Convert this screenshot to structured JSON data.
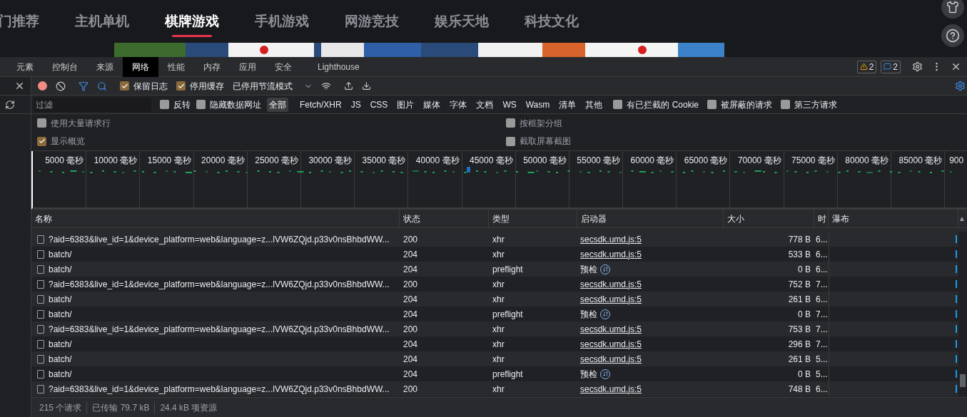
{
  "site_nav": {
    "items": [
      {
        "label": "门推荐",
        "selected": false
      },
      {
        "label": "主机单机",
        "selected": false
      },
      {
        "label": "棋牌游戏",
        "selected": true
      },
      {
        "label": "手机游戏",
        "selected": false
      },
      {
        "label": "网游竞技",
        "selected": false
      },
      {
        "label": "娱乐天地",
        "selected": false
      },
      {
        "label": "科技文化",
        "selected": false
      }
    ]
  },
  "devtools": {
    "tabs": [
      {
        "label": "元素",
        "selected": false
      },
      {
        "label": "控制台",
        "selected": false
      },
      {
        "label": "来源",
        "selected": false
      },
      {
        "label": "网络",
        "selected": true
      },
      {
        "label": "性能",
        "selected": false
      },
      {
        "label": "内存",
        "selected": false
      },
      {
        "label": "应用",
        "selected": false
      },
      {
        "label": "安全",
        "selected": false
      },
      {
        "label": "Lighthouse",
        "selected": false
      }
    ],
    "warnings": "2",
    "messages": "2",
    "toolbar": {
      "recording": true,
      "preserve_log": {
        "label": "保留日志",
        "checked": true
      },
      "disable_cache": {
        "label": "停用缓存",
        "checked": true
      },
      "throttle": "已停用节流模式"
    },
    "filter": {
      "placeholder": "过滤",
      "invert": {
        "label": "反转",
        "checked": false
      },
      "hide_data_urls": {
        "label": "隐藏数据网址",
        "checked": false
      },
      "types": [
        {
          "label": "全部",
          "selected": true
        },
        {
          "label": "Fetch/XHR",
          "selected": false
        },
        {
          "label": "JS",
          "selected": false
        },
        {
          "label": "CSS",
          "selected": false
        },
        {
          "label": "图片",
          "selected": false
        },
        {
          "label": "媒体",
          "selected": false
        },
        {
          "label": "字体",
          "selected": false
        },
        {
          "label": "文档",
          "selected": false
        },
        {
          "label": "WS",
          "selected": false
        },
        {
          "label": "Wasm",
          "selected": false
        },
        {
          "label": "清单",
          "selected": false
        },
        {
          "label": "其他",
          "selected": false
        }
      ],
      "extra": [
        {
          "label": "有已拦截的 Cookie",
          "checked": false
        },
        {
          "label": "被屏蔽的请求",
          "checked": false
        },
        {
          "label": "第三方请求",
          "checked": false
        }
      ]
    },
    "options_left": [
      {
        "label": "使用大量请求行",
        "checked": false
      },
      {
        "label": "显示概览",
        "checked": true
      }
    ],
    "options_right": [
      {
        "label": "按框架分组",
        "checked": false
      },
      {
        "label": "截取屏幕截图",
        "checked": false
      }
    ],
    "timeline_ticks": [
      "5000 毫秒",
      "10000 毫秒",
      "15000 毫秒",
      "20000 毫秒",
      "25000 毫秒",
      "30000 毫秒",
      "35000 毫秒",
      "40000 毫秒",
      "45000 毫秒",
      "50000 毫秒",
      "55000 毫秒",
      "60000 毫秒",
      "65000 毫秒",
      "70000 毫秒",
      "75000 毫秒",
      "80000 毫秒",
      "85000 毫秒",
      "900"
    ],
    "columns": [
      "名称",
      "状态",
      "类型",
      "启动器",
      "大小",
      "时",
      "瀑布"
    ],
    "sort_indicator": "▲",
    "rows": [
      {
        "name": "?aid=6383&live_id=1&device_platform=web&language=z...lVW6ZQjd.p33v0nsBhbdWW...",
        "status": "200",
        "type": "xhr",
        "initiator": "secsdk.umd.js:5",
        "kind": "link",
        "size": "778 B",
        "time": "6..."
      },
      {
        "name": "batch/",
        "status": "204",
        "type": "xhr",
        "initiator": "secsdk.umd.js:5",
        "kind": "link",
        "size": "533 B",
        "time": "6..."
      },
      {
        "name": "batch/",
        "status": "204",
        "type": "preflight",
        "initiator": "预检",
        "kind": "preflight",
        "size": "0 B",
        "time": "6..."
      },
      {
        "name": "?aid=6383&live_id=1&device_platform=web&language=z...lVW6ZQjd.p33v0nsBhbdWW...",
        "status": "200",
        "type": "xhr",
        "initiator": "secsdk.umd.js:5",
        "kind": "link",
        "size": "752 B",
        "time": "7..."
      },
      {
        "name": "batch/",
        "status": "204",
        "type": "xhr",
        "initiator": "secsdk.umd.js:5",
        "kind": "link",
        "size": "261 B",
        "time": "6..."
      },
      {
        "name": "batch/",
        "status": "204",
        "type": "preflight",
        "initiator": "预检",
        "kind": "preflight",
        "size": "0 B",
        "time": "7..."
      },
      {
        "name": "?aid=6383&live_id=1&device_platform=web&language=z...lVW6ZQjd.p33v0nsBhbdWW...",
        "status": "200",
        "type": "xhr",
        "initiator": "secsdk.umd.js:5",
        "kind": "link",
        "size": "753 B",
        "time": "7..."
      },
      {
        "name": "batch/",
        "status": "204",
        "type": "xhr",
        "initiator": "secsdk.umd.js:5",
        "kind": "link",
        "size": "296 B",
        "time": "7..."
      },
      {
        "name": "batch/",
        "status": "204",
        "type": "xhr",
        "initiator": "secsdk.umd.js:5",
        "kind": "link",
        "size": "261 B",
        "time": "5..."
      },
      {
        "name": "batch/",
        "status": "204",
        "type": "preflight",
        "initiator": "预检",
        "kind": "preflight",
        "size": "0 B",
        "time": "5..."
      },
      {
        "name": "?aid=6383&live_id=1&device_platform=web&language=z...lVW6ZQjd.p33v0nsBhbdWW...",
        "status": "200",
        "type": "xhr",
        "initiator": "secsdk.umd.js:5",
        "kind": "link",
        "size": "748 B",
        "time": "6..."
      }
    ],
    "status_bar": [
      "215 个请求",
      "已传输 79.7 kB",
      "24.4 kB 项资源"
    ]
  }
}
